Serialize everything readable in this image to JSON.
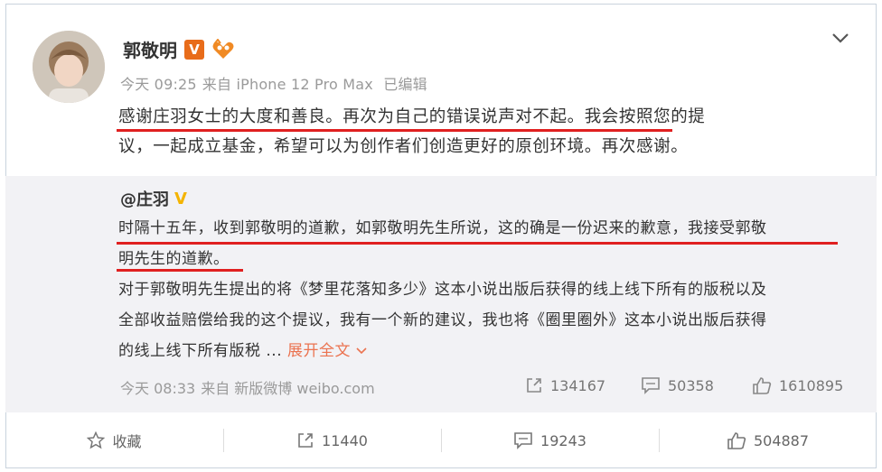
{
  "post": {
    "username": "郭敬明",
    "verified_label": "V",
    "timestamp": "今天 09:25",
    "source": "来自 iPhone 12 Pro Max",
    "edited": "已编辑",
    "content_line1": "感谢庄羽女士的大度和善良。再次为自己的错误说声对不起。我会按照您的提",
    "content_line2": "议，一起成立基金，希望可以为创作者们创造更好的原创环境。再次感谢。"
  },
  "repost": {
    "author": "@庄羽",
    "verified_label": "V",
    "line1": "时隔十五年，收到郭敬明的道歉，如郭敬明先生所说，这的确是一份迟来的歉意，我接受郭敬",
    "line2": "明先生的道歉。",
    "line3": "对于郭敬明先生提出的将《梦里花落知多少》这本小说出版后获得的线上线下所有的版税以及",
    "line4": "全部收益赔偿给我的这个提议，我有一个新的建议，我也将《圈里圈外》这本小说出版后获得",
    "line5": "的线上线下所有版税 ...",
    "expand_label": "展开全文",
    "timestamp": "今天 08:33",
    "source": "来自 新版微博 weibo.com",
    "repost_count": "134167",
    "comment_count": "50358",
    "like_count": "1610895"
  },
  "actions": {
    "favorite_label": "收藏",
    "repost_count": "11440",
    "comment_count": "19243",
    "like_count": "504887"
  },
  "colors": {
    "accent": "#eb7350",
    "underline": "#e02020",
    "verified_orange": "#e86c1a",
    "verified_gold": "#f4b400"
  }
}
